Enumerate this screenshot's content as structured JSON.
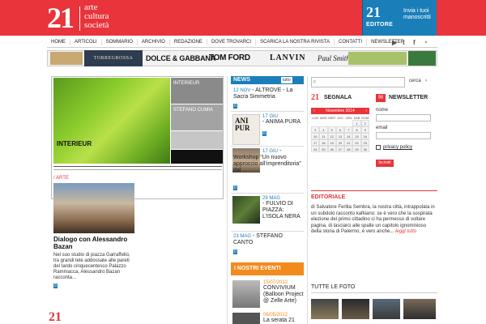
{
  "header": {
    "logo_number": "21",
    "logo_words": [
      "arte",
      "cultura",
      "società"
    ],
    "editore_number": "21",
    "editore_label": "EDITORE",
    "editore_text": "Invia i tuoi manoscritti",
    "color": "#e8343a",
    "editore_color": "#1a7fb8"
  },
  "nav": {
    "items": [
      "HOME",
      "ARTICOLI",
      "SOMMARIO",
      "ARCHIVIO",
      "REDAZIONE",
      "DOVE TROVARCI",
      "SCARICA LA NOSTRA RIVISTA",
      "CONTATTI",
      "NEWSLETTER"
    ],
    "social": [
      "youtube-icon",
      "twitter-icon",
      "facebook-icon",
      "rss-icon"
    ]
  },
  "ads": {
    "torregrossa": "TORREGROSSA",
    "dolce_gabbana": "DOLCE & GABBANA",
    "tom_ford": "TOM FORD",
    "lanvin": "LANVIN",
    "paul_smith": "Paul Smith"
  },
  "featured": {
    "caption": "INTERIEUR",
    "thumbs": [
      "INTERIEUR",
      "STEFANO CUMIA",
      "",
      ""
    ]
  },
  "article": {
    "category": "/ ARTE",
    "title": "Dialogo con Alessandro Bazan",
    "body": "Nel suo studio di piazza Garraffello, tra grandi tele addossate alle pareti del tardo cinquecentesco Palazzo Rammacca, Alessandro Bazan racconta...",
    "comments": "0"
  },
  "news": {
    "label": "NEWS",
    "all_label": "tutto",
    "items": [
      {
        "date": "12 NOV",
        "title": "- ALTROVE - La Sacra Simmetria",
        "comments": "0"
      },
      {
        "date": "17 GIU",
        "title": "- ANIMA PURA",
        "comments": "0"
      },
      {
        "date": "17 GIU",
        "title": "- Workshop “Un nuovo approccio all’imprenditoria” dal",
        "comments": "0"
      },
      {
        "date": "29 MAG",
        "title": "- FULVIO DI PIAZZA: L’ISOLA NERA",
        "comments": "0"
      },
      {
        "date": "23 MAG",
        "title": "- STEFANO CANTO",
        "comments": "0"
      }
    ]
  },
  "events": {
    "label": "I NOSTRI EVENTI",
    "items": [
      {
        "date": "15/07/2012",
        "title": "CONVIVIUM (Balloon Project @ Zelle Arte)"
      },
      {
        "date": "06/05/2012",
        "title": "La serata 21"
      }
    ]
  },
  "search": {
    "placeholder": "",
    "button": "cerca"
  },
  "segnala": {
    "number": "21",
    "label": "SEGNALA",
    "calendar": {
      "month": "Novembre 2014",
      "days": [
        "LUN",
        "MAR",
        "MER",
        "GIO",
        "VEN",
        "SAB",
        "DOM"
      ],
      "cells": [
        "",
        "",
        "",
        "",
        "",
        "1",
        "2",
        "3",
        "4",
        "5",
        "6",
        "7",
        "8",
        "9",
        "10",
        "11",
        "12",
        "13",
        "14",
        "15",
        "16",
        "17",
        "18",
        "19",
        "20",
        "21",
        "22",
        "23",
        "24",
        "25",
        "26",
        "27",
        "28",
        "29",
        "30"
      ]
    }
  },
  "newsletter": {
    "label": "NEWSLETTER",
    "name_label": "nome",
    "email_label": "email",
    "privacy": "privacy policy",
    "button": "Iscriviti"
  },
  "editoriale": {
    "label": "EDITORIALE",
    "text": "di Salvatore Ferlita Sembra, la nostra città, intrappolata in un subdolo racconto kafkiano: se è vero che la sospirata elezione del primo cittadino ci ha permesso di voltare pagina, di lasciarci alle spalle un capitolo ignominioso della storia di Palermo, è vero anche...",
    "more": "leggi tutto"
  },
  "foto": {
    "label": "TUTTE LE FOTO"
  }
}
